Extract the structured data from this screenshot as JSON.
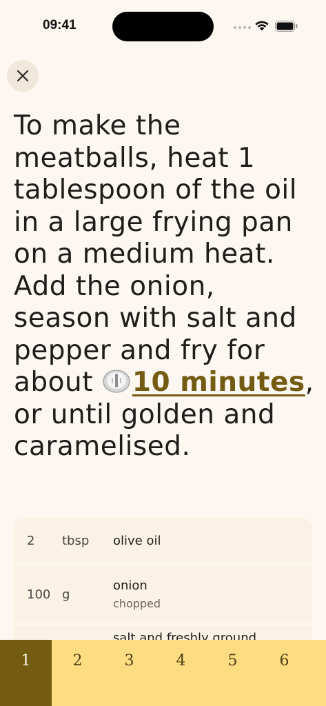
{
  "status_bar": {
    "time": "09:41"
  },
  "instruction": {
    "before": "To make the meatballs, heat 1 tablespoon of the oil in a large frying pan on a medium heat. Add the onion, season with salt and pepper and fry for about ",
    "timer_label": "10 minutes",
    "after": ", or until golden and caramelised."
  },
  "ingredients": [
    {
      "qty": "2",
      "unit": "tbsp",
      "name": "olive oil",
      "note": ""
    },
    {
      "qty": "100",
      "unit": "g",
      "name": "onion",
      "note": "chopped"
    },
    {
      "qty": "",
      "unit": "",
      "name": "salt and freshly ground",
      "note": ""
    }
  ],
  "steps": [
    "1",
    "2",
    "3",
    "4",
    "5",
    "6"
  ],
  "active_step": "1",
  "colors": {
    "accent": "#735b12",
    "step_bar": "#fedc81",
    "background": "#fdf7f1"
  }
}
